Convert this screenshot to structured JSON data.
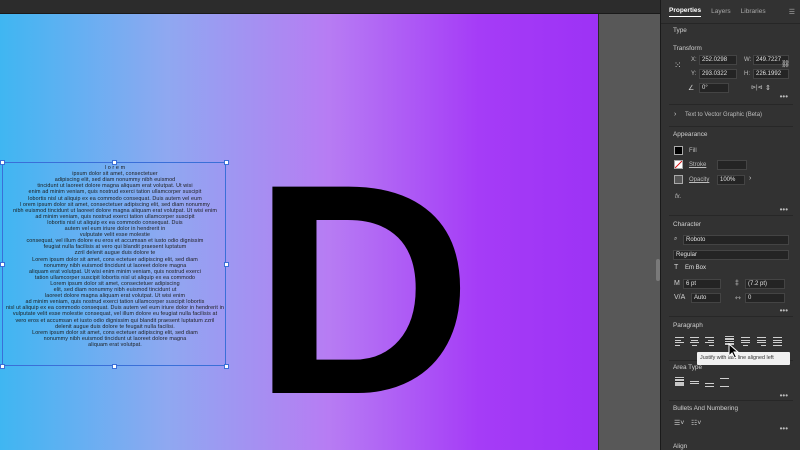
{
  "panel": {
    "tabs": [
      {
        "label": "Properties",
        "active": true
      },
      {
        "label": "Layers",
        "active": false
      },
      {
        "label": "Libraries",
        "active": false
      }
    ],
    "type_label": "Type",
    "transform": {
      "title": "Transform",
      "x_label": "X:",
      "x_value": "252.0298",
      "y_label": "Y:",
      "y_value": "293.0322",
      "w_label": "W:",
      "w_value": "249.7227",
      "h_label": "H:",
      "h_value": "226.1992",
      "rotate_value": "0°"
    },
    "text_to_vector": "Text to Vector Graphic (Beta)",
    "appearance": {
      "title": "Appearance",
      "fill_label": "Fill",
      "stroke_label": "Stroke",
      "opacity_label": "Opacity",
      "opacity_value": "100%",
      "fx_label": "fx."
    },
    "character": {
      "title": "Character",
      "font_family": "Roboto",
      "font_style": "Regular",
      "glyph_box": "Em Box",
      "size": "6 pt",
      "leading": "(7.2 pt)",
      "kerning": "Auto",
      "tracking": "0"
    },
    "paragraph": {
      "title": "Paragraph",
      "tooltip": "Justify with last line aligned left"
    },
    "area_type_title": "Area Type",
    "bullets_title": "Bullets And Numbering",
    "align_title": "Align"
  },
  "canvas": {
    "letter": "D",
    "gradient": [
      "#3fb6f2",
      "#b77cf3",
      "#9d32f5"
    ],
    "area_text_lines": [
      "l o r e m",
      "ipsum   dolor   sit   amet,   consectetuer",
      "adipiscing elit, sed diam nonummy nibh euismod",
      "tincidunt ut laoreet dolore magna aliquam erat volutpat. Ut wisi",
      "enim ad minim veniam, quis nostrud exerci tation ullamcorper suscipit",
      "lobortis nisl ut aliquip ex ea commodo consequat. Duis autem vel eum",
      "l orem ipsum dolor sit amet, consectetuer adipiscing elit, sed diam nonummy",
      "nibh euismod tincidunt ut laoreet dolore magna aliquam erat volutpat. Ut wisi enim",
      "ad   minim   veniam,   quis   nostrud                  exerci tation ullamcorper suscipit",
      "lobortis nisl ut aliquip ex ea                  commodo   consequat.   Duis",
      "autem vel eum iriure dolor in                  hendrerit   in",
      "vulputate velit esse molestie",
      "consequat, vel illum dolore eu          eros et accumsan et iusto odio dignissim",
      "feugiat nulla facilisis at vero          qui blandit praesent luptatum",
      "zzril delenit augue duis dolore te",
      "Lorem ipsum dolor sit amet,          cons ectetuer adipiscing elit, sed diam",
      "nonummy    nibh    euismod          tincidunt ut laoreet dolore magna",
      "aliquam erat volutpat. Ut wisi enim          minim veniam, quis nostrud exerci",
      "tation ullamcorper suscipit lobortis          nisl ut aliquip ex ea commodo",
      "Lorem ipsum dolor sit amet,          consectetuer adipiscing",
      "elit, sed diam nonummy nibh          euismod tincidunt ut",
      "laoreet dolore magna aliquam          erat volutpat. Ut wisi enim",
      "ad minim veniam, quis nostrud exerci          tation ullamcorper suscipit lobortis",
      "nisl ut aliquip ex ea commodo consequat. Duis autem vel eum iriure dolor in hendrerit in",
      "vulputate velit esse molestie consequat, vel illum dolore eu feugiat nulla facilisis at",
      "vero eros et accumsan et iusto odio dignissim qui blandit praesent luptatum zzril",
      "delenit augue duis dolore te feugait nulla facilisi.",
      "Lorem ipsum dolor sit amet, cons ectetuer adipiscing elit, sed diam",
      "nonummy nibh euismod tincidunt ut laoreet dolore magna",
      "aliquam erat volutpat."
    ]
  }
}
